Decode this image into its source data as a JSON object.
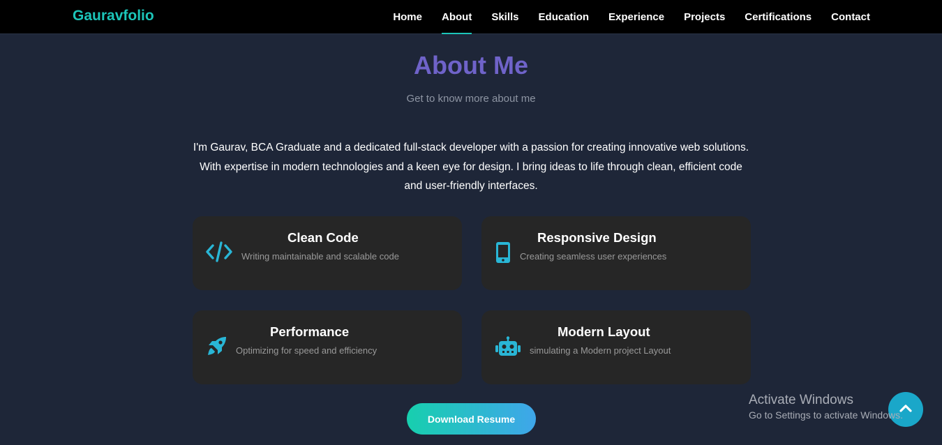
{
  "nav": {
    "brand": "Gauravfolio",
    "links": [
      {
        "label": "Home"
      },
      {
        "label": "About"
      },
      {
        "label": "Skills"
      },
      {
        "label": "Education"
      },
      {
        "label": "Experience"
      },
      {
        "label": "Projects"
      },
      {
        "label": "Certifications"
      },
      {
        "label": "Contact"
      }
    ],
    "active": "About"
  },
  "about": {
    "title": "About Me",
    "subtitle": "Get to know more about me",
    "intro": "I'm Gaurav, BCA Graduate and a dedicated full-stack developer with a passion for creating innovative web solutions. With expertise in modern technologies and a keen eye for design. I bring ideas to life through clean, efficient code and user-friendly interfaces.",
    "cards": [
      {
        "title": "Clean Code",
        "desc": "Writing maintainable and scalable code",
        "icon": "code-icon"
      },
      {
        "title": "Responsive Design",
        "desc": "Creating seamless user experiences",
        "icon": "mobile-icon"
      },
      {
        "title": "Performance",
        "desc": "Optimizing for speed and efficiency",
        "icon": "rocket-icon"
      },
      {
        "title": "Modern Layout",
        "desc": "simulating a Modern project Layout",
        "icon": "robot-icon"
      }
    ],
    "download_label": "Download Resume"
  },
  "overlay": {
    "activate_title": "Activate Windows",
    "activate_desc": "Go to Settings to activate Windows."
  },
  "colors": {
    "brand": "#1cc5b9",
    "title": "#6f63c9",
    "icon": "#29b6d6",
    "background": "#1e2638",
    "card": "#262626"
  }
}
